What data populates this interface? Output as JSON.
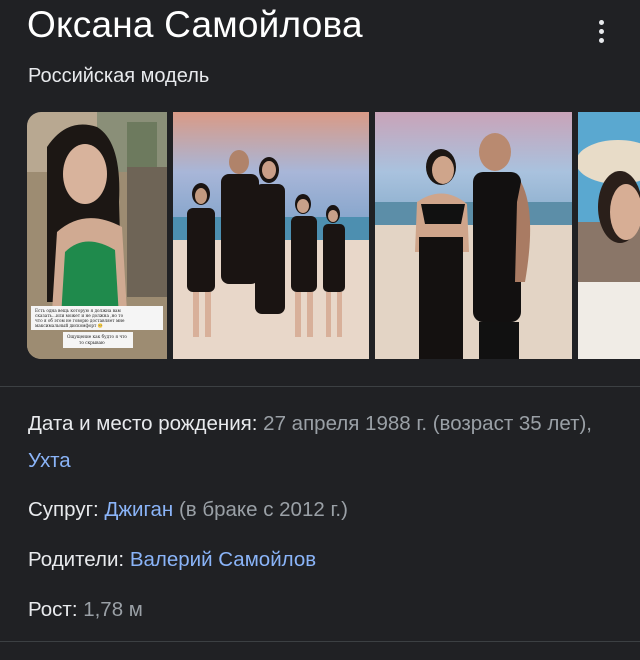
{
  "header": {
    "title": "Оксана Самойлова",
    "subtitle": "Российская модель",
    "more_icon": "more-vert-icon"
  },
  "gallery": {
    "photo1_caption_lines": [
      "Есть одна вещь которую я должна вам",
      "сказать…или может и не должна ,но то",
      "что я об этом не говорю доставляет мне",
      "максимальный дискомфорт 🥺",
      "Ощущение как будто я что",
      "то скрываю"
    ]
  },
  "facts": {
    "birth": {
      "label": "Дата и место рождения:",
      "value": " 27 апреля 1988 г. (возраст 35 лет), ",
      "link": "Ухта"
    },
    "spouse": {
      "label": "Супруг:",
      "link": "Джиган",
      "value": " (в браке с 2012 г.)"
    },
    "parents": {
      "label": "Родители:",
      "link": "Валерий Самойлов"
    },
    "height": {
      "label": "Рост:",
      "value": " 1,78 м"
    }
  },
  "colors": {
    "background": "#202124",
    "text": "#e8eaed",
    "muted": "#9aa0a6",
    "link": "#8ab4f8",
    "divider": "#3c4043"
  }
}
